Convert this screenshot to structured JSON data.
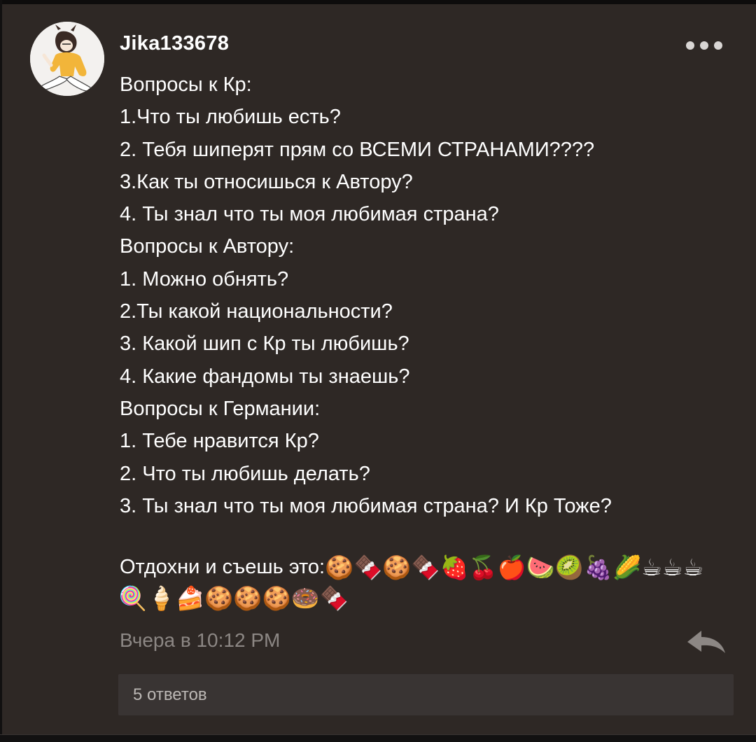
{
  "comment": {
    "username": "Jika133678",
    "lines": [
      "Вопросы к Кр:",
      "1.Что ты любишь есть?",
      "2. Тебя шиперят прям со ВСЕМИ СТРАНАМИ????",
      "3.Как ты относишься к Автору?",
      "4. Ты знал что ты моя любимая страна?",
      "Вопросы к Автору:",
      "1. Можно обнять?",
      "2.Ты какой национальности?",
      "3. Какой шип с Кр ты любишь?",
      "4. Какие фандомы ты знаешь?",
      "Вопросы к Германии:",
      "1. Тебе нравится Кр?",
      "2. Что ты любишь делать?",
      "3. Ты знал что ты моя любимая страна? И Кр Тоже?"
    ],
    "treat_prefix": "Отдохни и съешь это:",
    "emojis_line1": [
      "🍪",
      "🍫",
      "🍪",
      "🍫",
      "🍓",
      "🍒",
      "🍎",
      "🍉",
      "🥝",
      "🍇",
      "🌽",
      "☕",
      "☕",
      "☕"
    ],
    "emojis_line2": [
      "🍭",
      "🍦",
      "🍰",
      "🍪",
      "🍪",
      "🍪",
      "🍩",
      "🍫"
    ],
    "timestamp": "Вчера в 10:12 PM",
    "replies_label": "5 ответов"
  },
  "icons": {
    "more": "more-dots-icon",
    "reply": "reply-arrow-icon",
    "avatar": "user-avatar"
  },
  "colors": {
    "background": "#2e2825",
    "text": "#ffffff",
    "timestamp": "#8c8784",
    "replies_bar": "#393433"
  }
}
